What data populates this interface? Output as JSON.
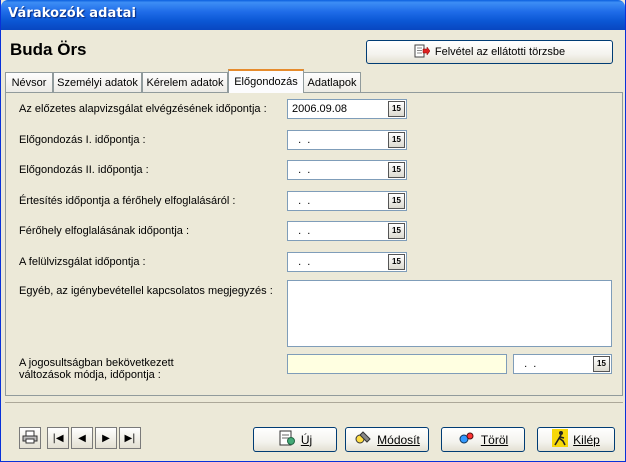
{
  "window": {
    "title": "Várakozók adatai"
  },
  "person": {
    "name": "Buda Örs"
  },
  "header": {
    "enroll_button": "Felvétel az ellátotti törzsbe"
  },
  "tabs": [
    {
      "label": "Névsor",
      "active": false
    },
    {
      "label": "Személyi adatok",
      "active": false
    },
    {
      "label": "Kérelem adatok",
      "active": false
    },
    {
      "label": "Előgondozás",
      "active": true
    },
    {
      "label": "Adatlapok",
      "active": false
    }
  ],
  "form": {
    "fields": [
      {
        "label": "Az előzetes alapvizsgálat elvégzésének időpontja :",
        "value": "2006.09.08"
      },
      {
        "label": "Előgondozás I. időpontja :",
        "value": "  .  ."
      },
      {
        "label": "Előgondozás II. időpontja :",
        "value": "  .  ."
      },
      {
        "label": "Értesítés időpontja a férőhely elfoglalásáról :",
        "value": "  .  ."
      },
      {
        "label": "Férőhely elfoglalásának időpontja :",
        "value": "  .  ."
      },
      {
        "label": "A felülvizsgálat időpontja :",
        "value": "  .  ."
      }
    ],
    "note_label": "Egyéb, az igénybevétellel kapcsolatos megjegyzés :",
    "note_value": "",
    "changes_label": "A jogosultságban bekövetkezett változások módja, időpontja :",
    "changes_mode": "",
    "changes_date": "  .  .",
    "calendar_glyph": "15"
  },
  "footer": {
    "print_icon": "printer-icon",
    "nav": [
      "|◀",
      "◀",
      "▶",
      "▶|"
    ],
    "new_label": "Új",
    "modify_label": "Módosít",
    "delete_label": "Töröl",
    "exit_label": "Kilép"
  },
  "colors": {
    "titlebar": "#0b57d4",
    "window_bg": "#ece9d8",
    "active_tab_accent": "#e68b2c",
    "highlight_field": "#ffffe1"
  }
}
